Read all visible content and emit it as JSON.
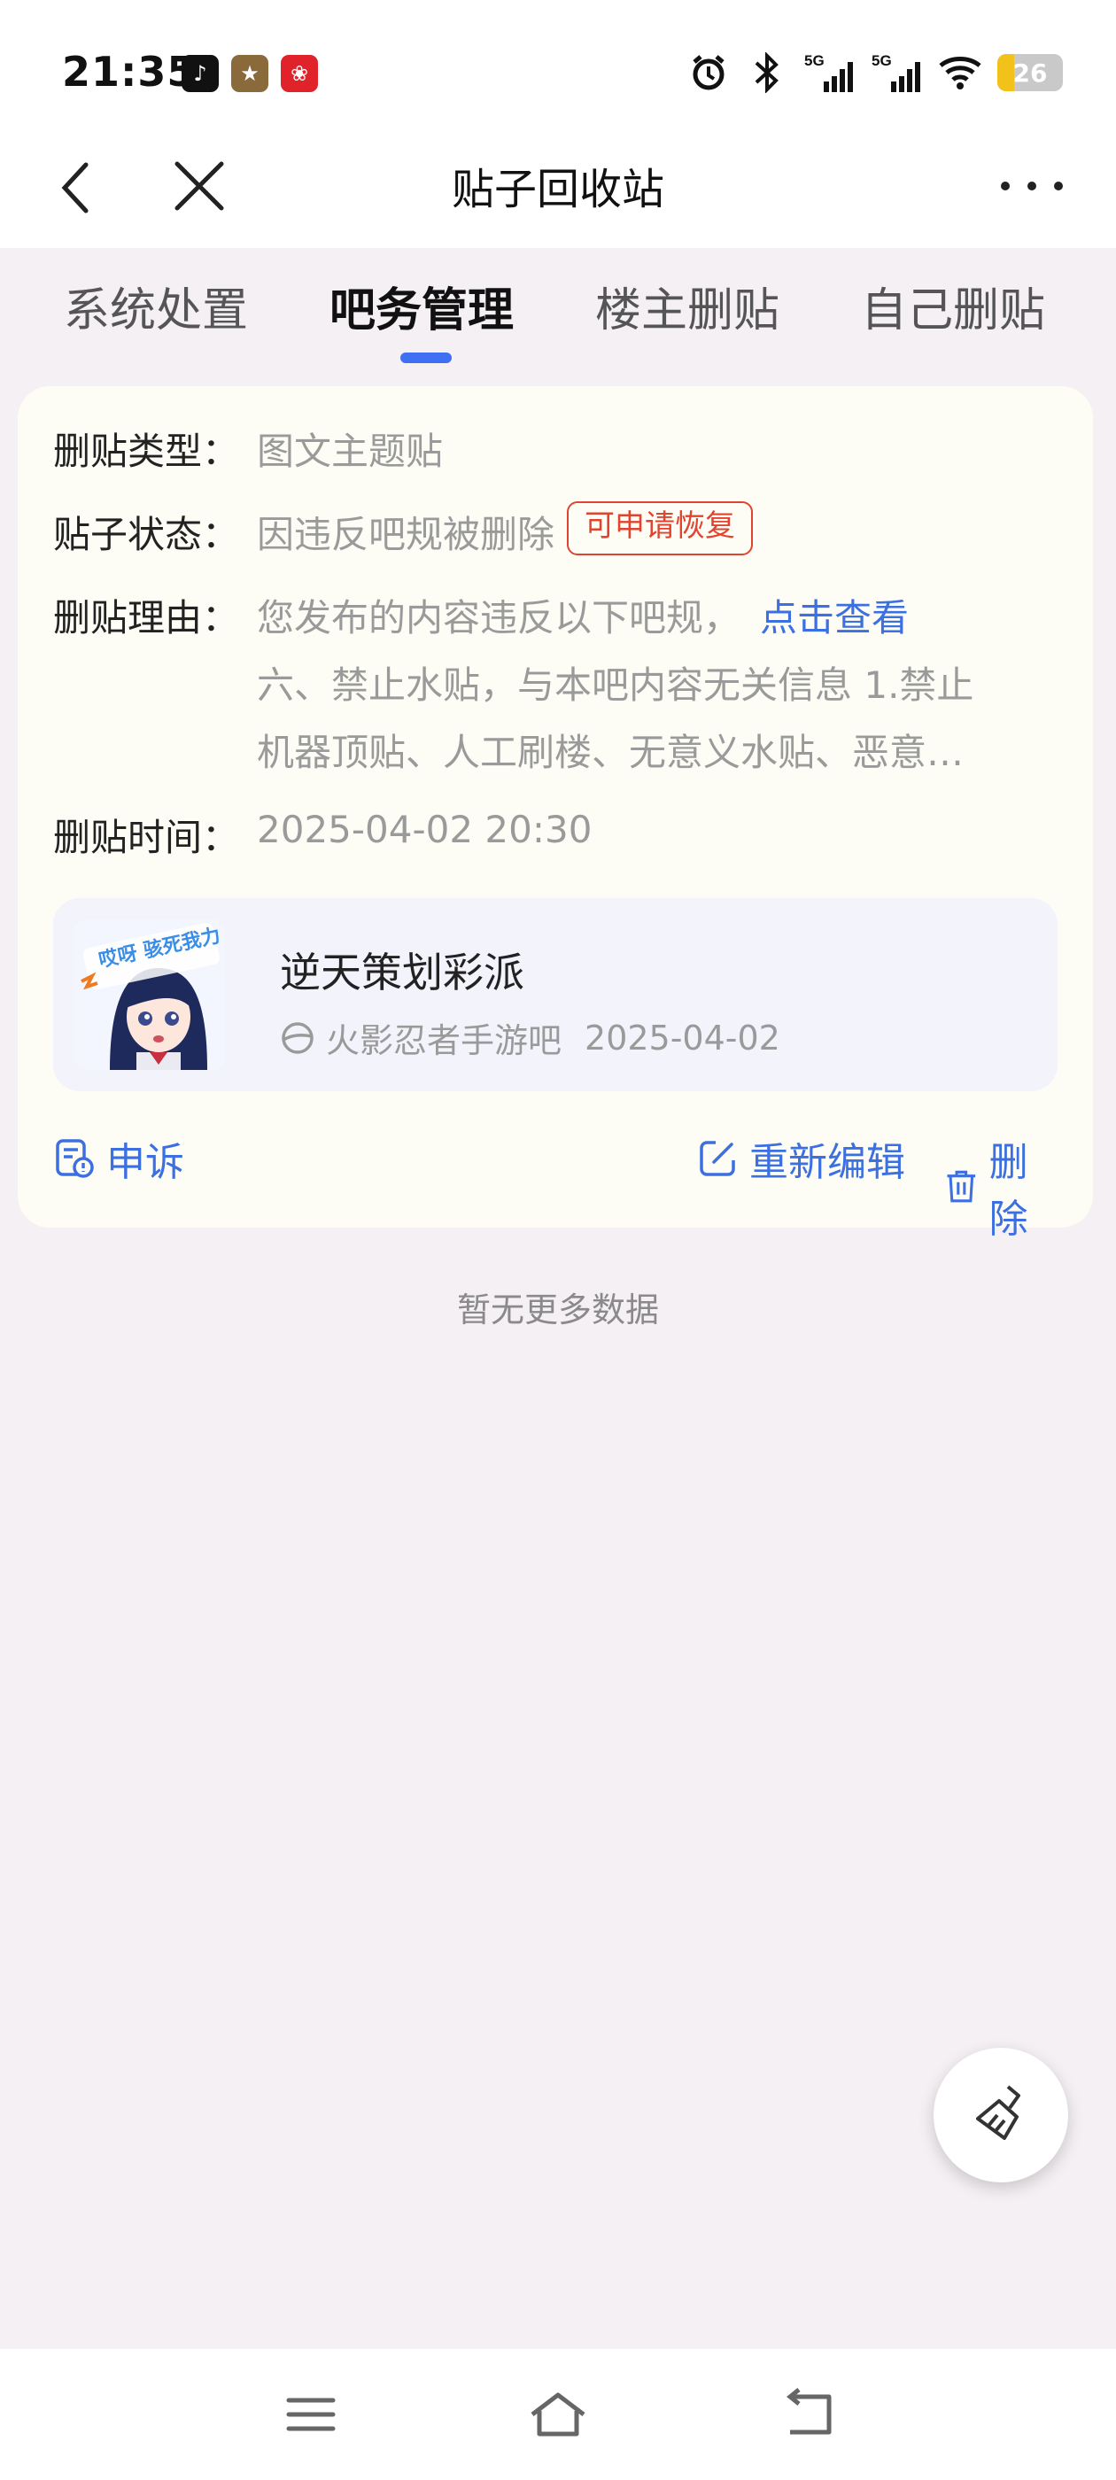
{
  "status_bar": {
    "time": "21:35",
    "apps": [
      "tiktok-icon",
      "game-icon",
      "shopping-icon"
    ],
    "network": "5G",
    "network2": "5G",
    "battery_level": "26",
    "battery_percent": 26
  },
  "header": {
    "title": "贴子回收站"
  },
  "tabs": [
    {
      "label": "系统处置",
      "active": false
    },
    {
      "label": "吧务管理",
      "active": true
    },
    {
      "label": "楼主删贴",
      "active": false
    },
    {
      "label": "自己删贴",
      "active": false
    }
  ],
  "record": {
    "type_label": "删贴类型：",
    "type_value": "图文主题贴",
    "status_label": "贴子状态：",
    "status_value": "因违反吧规被删除",
    "status_badge": "可申请恢复",
    "reason_label": "删贴理由：",
    "reason_value": "您发布的内容违反以下吧规，",
    "reason_link": "点击查看",
    "reason_line1": "六、禁止水贴，与本吧内容无关信息 1.禁止",
    "reason_line2": "机器顶贴、人工刷楼、无意义水贴、恶意…",
    "time_label": "删贴时间：",
    "time_value": "2025-04-02 20:30",
    "post": {
      "title": "逆天策划彩派",
      "forum": "火影忍者手游吧",
      "date": "2025-04-02",
      "sticker_text": "哎呀 骇死我力"
    },
    "actions": {
      "appeal": "申诉",
      "reedit": "重新编辑",
      "delete": "删除"
    }
  },
  "footer_text": "暂无更多数据",
  "colors": {
    "accent": "#3f6ff3",
    "link": "#3c6fe0",
    "badge": "#e0442f",
    "background": "#f4f0f4"
  }
}
